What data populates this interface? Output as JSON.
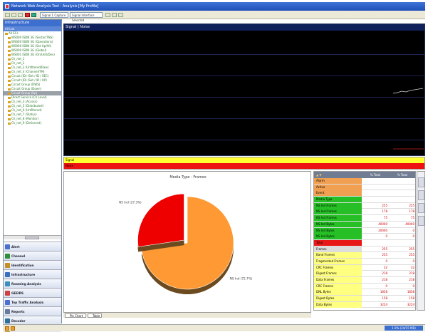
{
  "window": {
    "title": "Network Web Analysis Tool - Analysis [My Profile]"
  },
  "toolbar": {
    "combo1": "Signal 1 Capture",
    "combo2": "Signal Interface Selected"
  },
  "sidebar": {
    "title": "Infrastructure",
    "subtitle": "All List",
    "tree": [
      {
        "label": "All ECs",
        "selected": false
      },
      {
        "label": "WS000 ISDN 3G (Sector/TNS)",
        "selected": false
      },
      {
        "label": "WS000 ISDN 3G (Operations)",
        "selected": false
      },
      {
        "label": "WS000 ISDN 3G (Set Up/All)",
        "selected": false
      },
      {
        "label": "WS000 ISDN 3G (Global)",
        "selected": false
      },
      {
        "label": "WS001 ISDN 3G (On/Unit/Dev)",
        "selected": false
      },
      {
        "label": "Ch_net_1",
        "selected": false
      },
      {
        "label": "Ch_net_2",
        "selected": false
      },
      {
        "label": "Ch_net_3 (Unfiltered/Raw)",
        "selected": false
      },
      {
        "label": "Ch_net_4 (Channel/TM)",
        "selected": false
      },
      {
        "label": "Circuit (ID) (Set / ID / SEC)",
        "selected": false
      },
      {
        "label": "Circuit (ID) (Set / ID / UP)",
        "selected": false
      },
      {
        "label": "Circuit Group (DWS)",
        "selected": false
      },
      {
        "label": "Circuit Group (Down)",
        "selected": false
      },
      {
        "label": "Circuit Group (Up)",
        "selected": true
      },
      {
        "label": "Direct Service (Ch Level)",
        "selected": false
      },
      {
        "label": "Ch_net_3 (Access)",
        "selected": false
      },
      {
        "label": "Ch_net_5 (Distributed)",
        "selected": false
      },
      {
        "label": "Ch_net_6 (Unfiltered)",
        "selected": false
      },
      {
        "label": "Ch_net_7 (Status)",
        "selected": false
      },
      {
        "label": "Ch_net_8 (Monitor)",
        "selected": false
      },
      {
        "label": "Ch_net_9 (Delivered)",
        "selected": false
      }
    ],
    "nav": [
      {
        "label": "Alert",
        "color": "#4a6fd0"
      },
      {
        "label": "Channel",
        "color": "#2f8f3a"
      },
      {
        "label": "Identification",
        "color": "#c29024"
      },
      {
        "label": "Infrastructure",
        "color": "#3a6fc0"
      },
      {
        "label": "Roaming Analysis",
        "color": "#3a8fc0"
      },
      {
        "label": "GEEIRS",
        "color": "#d04040"
      },
      {
        "label": "Top Traffic Analysis",
        "color": "#4a6fd0"
      },
      {
        "label": "Reports",
        "color": "#6a7a9a"
      },
      {
        "label": "Decoder",
        "color": "#2f6f9a"
      },
      {
        "label": "Call Trace",
        "color": "#c29024"
      }
    ]
  },
  "signal_panel": {
    "header": "Signal | Noise",
    "legend": [
      {
        "label": "Signal",
        "color": "#ffff33"
      },
      {
        "label": "Noise",
        "color": "#ee1111"
      }
    ]
  },
  "chart_panel": {
    "title": "Media Type - Frames"
  },
  "chart_data": {
    "type": "pie",
    "title": "Media Type - Frames",
    "series": [
      {
        "name": "NS_Ind",
        "value": 72.7,
        "color": "#ff9933",
        "label": "NS Ind (72.7%)"
      },
      {
        "name": "NS_Ind",
        "value": 27.3,
        "color": "#ee0000",
        "label": "NS Ind (27.3%)"
      }
    ]
  },
  "table": {
    "columns": [
      "",
      "% Total",
      "% Total"
    ],
    "rows": [
      {
        "label": "Alarm",
        "bg": "#f0a050",
        "v1": "",
        "v2": ""
      },
      {
        "label": "Active",
        "bg": "#f0a050",
        "v1": "",
        "v2": ""
      },
      {
        "label": "Event",
        "bg": "#f0a050",
        "v1": "",
        "v2": ""
      },
      {
        "label": "Media Type",
        "bg": "#26c026",
        "v1": "",
        "v2": ""
      },
      {
        "label": "NS Ind Frames",
        "bg": "#26c026",
        "v1": "255",
        "v2": "255"
      },
      {
        "label": "NS Ind Frames",
        "bg": "#26c026",
        "v1": "178",
        "v2": "178"
      },
      {
        "label": "NS Ind Frames",
        "bg": "#26c026",
        "v1": "75",
        "v2": "75"
      },
      {
        "label": "NS Ind Bytes",
        "bg": "#26c026",
        "v1": "40000",
        "v2": "40000"
      },
      {
        "label": "NS Ind Bytes",
        "bg": "#26c026",
        "v1": "20000",
        "v2": "0"
      },
      {
        "label": "NS Ind Bytes",
        "bg": "#26c026",
        "v1": "0",
        "v2": "0"
      },
      {
        "label": "Total",
        "bg": "#e81818",
        "v1": "",
        "v2": ""
      },
      {
        "label": "Frames",
        "bg": "#dddddd",
        "v1": "255",
        "v2": "255"
      },
      {
        "label": "Band Frames",
        "bg": "#ffff80",
        "v1": "255",
        "v2": "255"
      },
      {
        "label": "Fragmented Frames",
        "bg": "#ffff80",
        "v1": "0",
        "v2": "0"
      },
      {
        "label": "CRC Frames",
        "bg": "#ffff80",
        "v1": "32",
        "v2": "32"
      },
      {
        "label": "Digest Frames",
        "bg": "#ffff80",
        "v1": "218",
        "v2": "218"
      },
      {
        "label": "Data Frames",
        "bg": "#ffff80",
        "v1": "218",
        "v2": "218"
      },
      {
        "label": "CRC Frames",
        "bg": "#ffff80",
        "v1": "0",
        "v2": "0"
      },
      {
        "label": "DNL Bytes",
        "bg": "#ffff80",
        "v1": "1858",
        "v2": "1858"
      },
      {
        "label": "Digest Bytes",
        "bg": "#ffff80",
        "v1": "158",
        "v2": "158"
      },
      {
        "label": "Data Bytes",
        "bg": "#ffff80",
        "v1": "3224",
        "v2": "3224"
      }
    ]
  },
  "tabs": [
    "Pie Chart",
    "Table"
  ],
  "status": {
    "right": "1.0% (24/15 MB)"
  }
}
